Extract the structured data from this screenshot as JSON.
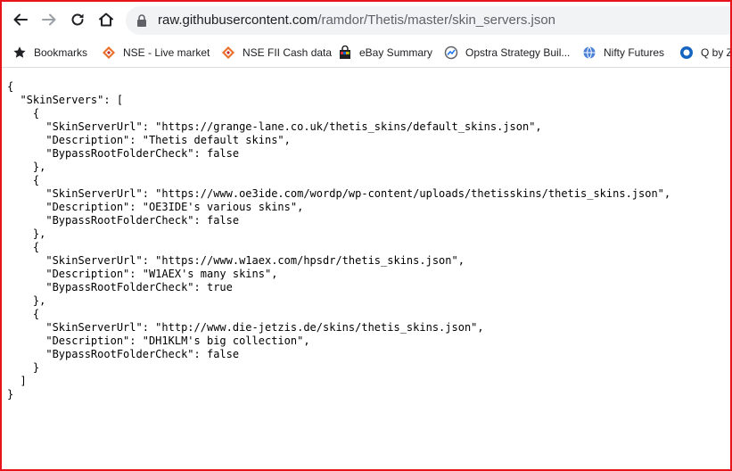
{
  "browser": {
    "url_host": "raw.githubusercontent.com",
    "url_path": "/ramdor/Thetis/master/skin_servers.json"
  },
  "bookmarks": [
    {
      "label": "Bookmarks",
      "icon": "star-icon"
    },
    {
      "label": "NSE - Live market",
      "icon": "nse-logo-icon"
    },
    {
      "label": "NSE FII Cash data",
      "icon": "nse-logo-icon"
    },
    {
      "label": "eBay Summary",
      "icon": "shopping-bag-icon"
    },
    {
      "label": "Opstra Strategy Buil...",
      "icon": "opstra-logo-icon"
    },
    {
      "label": "Nifty Futures",
      "icon": "globe-icon"
    },
    {
      "label": "Q by Z",
      "icon": "q-logo-icon"
    }
  ],
  "json_text": "{\n  \"SkinServers\": [\n    {\n      \"SkinServerUrl\": \"https://grange-lane.co.uk/thetis_skins/default_skins.json\",\n      \"Description\": \"Thetis default skins\",\n      \"BypassRootFolderCheck\": false\n    },\n    {\n      \"SkinServerUrl\": \"https://www.oe3ide.com/wordp/wp-content/uploads/thetisskins/thetis_skins.json\",\n      \"Description\": \"OE3IDE's various skins\",\n      \"BypassRootFolderCheck\": false\n    },\n    {\n      \"SkinServerUrl\": \"https://www.w1aex.com/hpsdr/thetis_skins.json\",\n      \"Description\": \"W1AEX's many skins\",\n      \"BypassRootFolderCheck\": true\n    },\n    {\n      \"SkinServerUrl\": \"http://www.die-jetzis.de/skins/thetis_skins.json\",\n      \"Description\": \"DH1KLM's big collection\",\n      \"BypassRootFolderCheck\": false\n    }\n  ]\n}",
  "colors": {
    "frame": "#e8141c",
    "omnibox": "#f1f3f4"
  }
}
